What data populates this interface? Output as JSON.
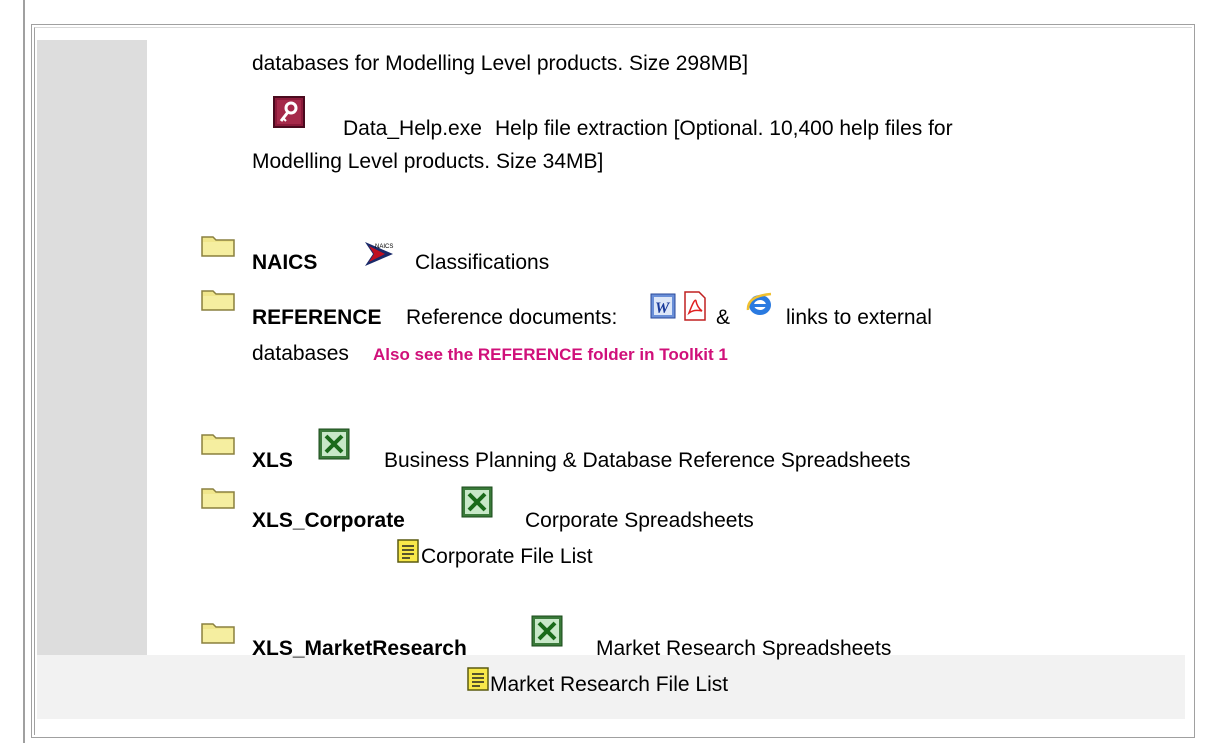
{
  "intro": {
    "line1": "databases for Modelling Level products. Size 298MB]"
  },
  "data_help": {
    "icon": "access-key-icon",
    "file": "Data_Help.exe",
    "desc": "Help file extraction [Optional. 10,400 help files for",
    "line2": "Modelling Level products. Size 34MB]"
  },
  "folders": [
    {
      "name": "NAICS",
      "icon": "naics-logo-icon",
      "desc": "Classifications"
    },
    {
      "name": "REFERENCE",
      "desc": "Reference documents:",
      "amp": "&",
      "desc_after": "links to external",
      "line2": "databases",
      "note": "Also see the REFERENCE folder in Toolkit 1",
      "icons": [
        "word-doc-icon",
        "pdf-icon",
        "internet-explorer-icon"
      ]
    },
    {
      "name": "XLS",
      "icon": "excel-icon",
      "desc": "Business Planning & Database Reference Spreadsheets"
    },
    {
      "name": "XLS_Corporate",
      "icon": "excel-icon",
      "desc": "Corporate Spreadsheets",
      "file_list": "Corporate File List"
    },
    {
      "name": "XLS_MarketResearch",
      "icon": "excel-icon",
      "desc": "Market Research Spreadsheets",
      "file_list": "Market Research File List"
    }
  ],
  "colors": {
    "note": "#d0107a",
    "strip": "#dddddd",
    "folder": "#f0e68c"
  }
}
